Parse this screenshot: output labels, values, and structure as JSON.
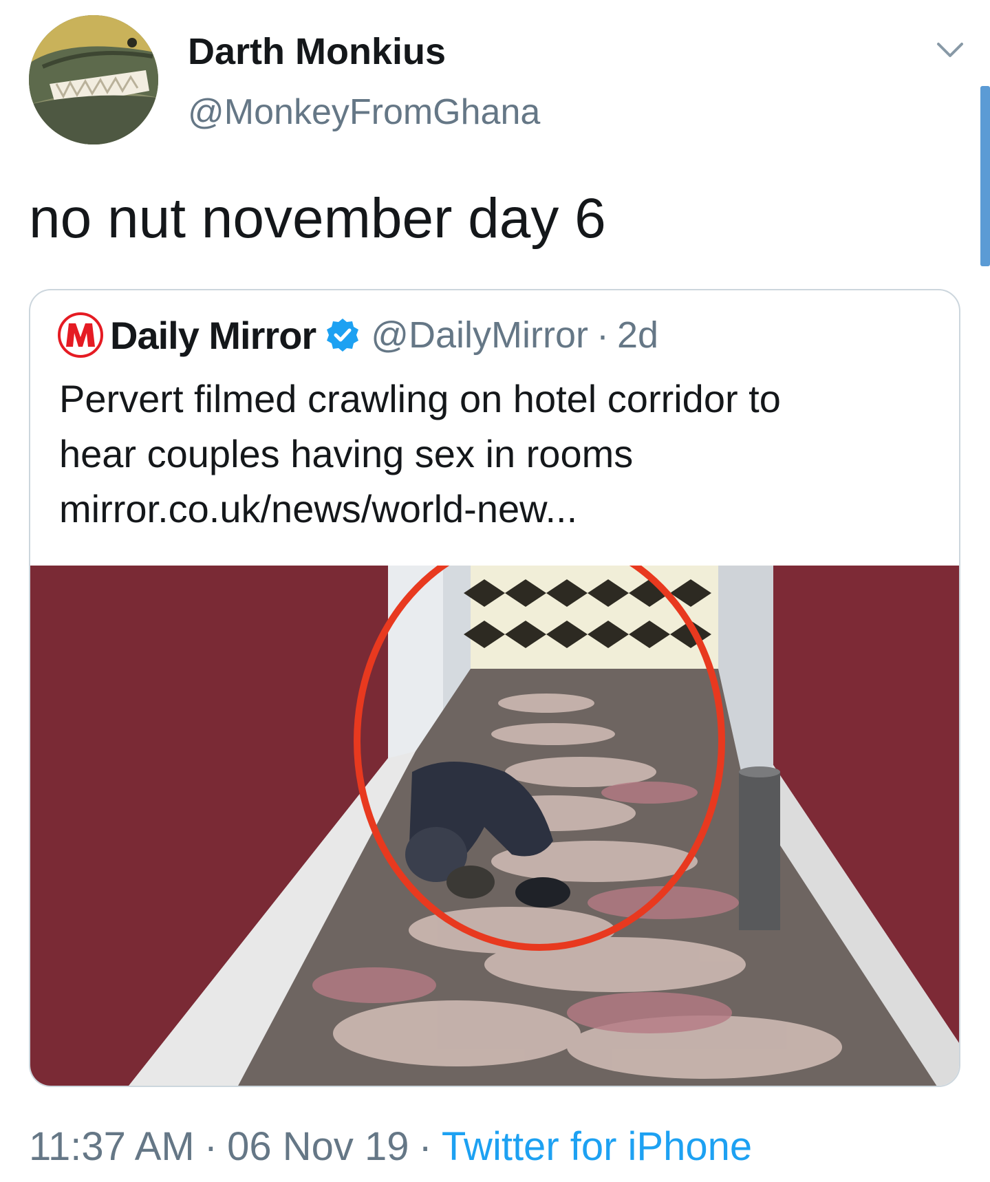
{
  "tweet": {
    "author": {
      "name": "Darth Monkius",
      "handle": "@MonkeyFromGhana",
      "avatar_icon": "crocodile-avatar"
    },
    "text": "no nut november day 6",
    "menu_icon": "chevron-down-icon"
  },
  "quoted": {
    "logo_letter": "M",
    "name": "Daily Mirror",
    "verified_icon": "verified-badge-icon",
    "handle": "@DailyMirror",
    "separator": "·",
    "time": "2d",
    "text_line1": "Pervert filmed crawling on hotel corridor to",
    "text_line2": "hear couples having sex in rooms",
    "link": "mirror.co.uk/news/world-new...",
    "media_description_icon": "corridor-photo"
  },
  "footer": {
    "time": "11:37 AM",
    "separator": "·",
    "date": "06 Nov 19",
    "source": "Twitter for iPhone"
  },
  "colors": {
    "text_primary": "#14171a",
    "text_secondary": "#657786",
    "link_blue": "#1da1f2",
    "mirror_red": "#e51b23",
    "card_border": "#ccd6dd"
  }
}
